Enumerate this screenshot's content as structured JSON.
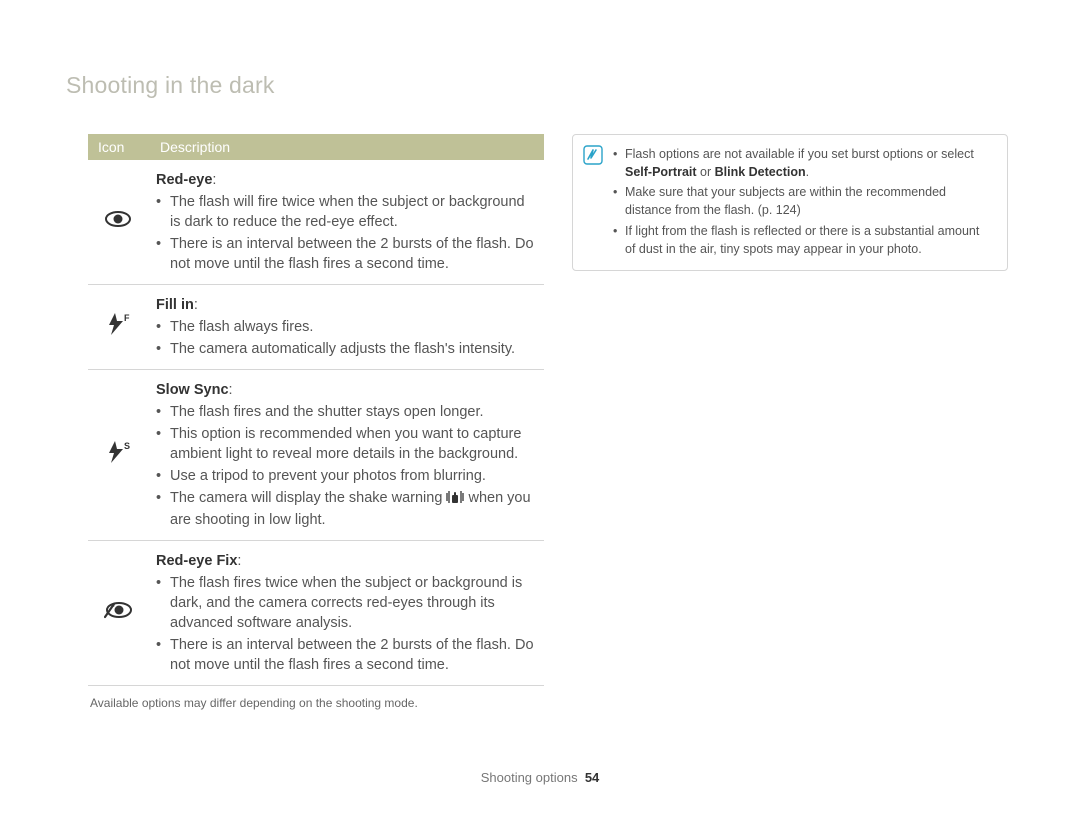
{
  "header": {
    "title": "Shooting in the dark"
  },
  "table": {
    "head_icon": "Icon",
    "head_desc": "Description",
    "rows": [
      {
        "icon": "eye",
        "label": "Red-eye",
        "items": [
          "The flash will fire twice when the subject or background is dark to reduce the red-eye effect.",
          "There is an interval between the 2 bursts of the flash. Do not move until the flash fires a second time."
        ]
      },
      {
        "icon": "fillin",
        "label": "Fill in",
        "items": [
          "The flash always fires.",
          "The camera automatically adjusts the flash's intensity."
        ]
      },
      {
        "icon": "slowsync",
        "label": "Slow Sync",
        "items": [
          "The flash fires and the shutter stays open longer.",
          "This option is recommended when you want to capture ambient light to reveal more details in the background.",
          "Use a tripod to prevent your photos from blurring.",
          "The camera will display the shake warning [SHAKE] when you are shooting in low light."
        ]
      },
      {
        "icon": "redeyefix",
        "label": "Red-eye Fix",
        "items": [
          "The flash fires twice when the subject or background is dark, and the camera corrects red-eyes through its advanced software analysis.",
          "There is an interval between the 2 bursts of the flash. Do not move until the flash fires a second time."
        ]
      }
    ]
  },
  "footnote": "Available options may differ depending on the shooting mode.",
  "notes": {
    "items": [
      {
        "pre": "Flash options are not available if you set burst options or select ",
        "bold": "Self-Portrait",
        "mid": " or ",
        "bold2": "Blink Detection",
        "post": "."
      },
      {
        "text": "Make sure that your subjects are within the recommended distance from the flash. (p. 124)"
      },
      {
        "text": "If light from the flash is reflected or there is a substantial amount of dust in the air, tiny spots may appear in your photo."
      }
    ]
  },
  "footer": {
    "label": "Shooting options",
    "page": "54"
  }
}
